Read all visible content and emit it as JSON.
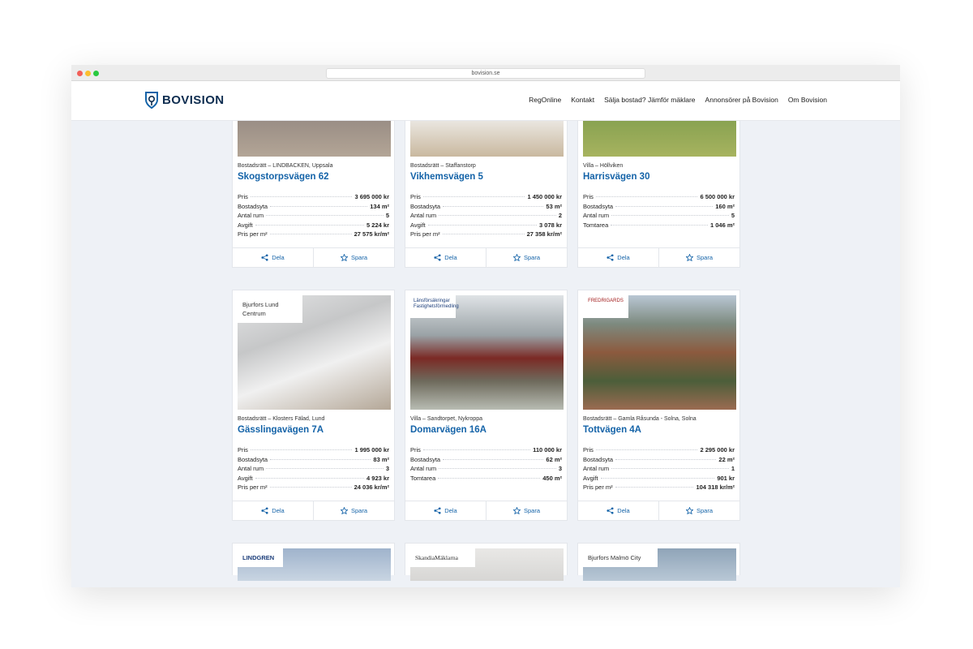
{
  "browser": {
    "url": "bovision.se"
  },
  "brand": {
    "name": "BOVISION",
    "color": "#0e2d50",
    "accent": "#1463a8"
  },
  "nav": [
    "RegOnline",
    "Kontakt",
    "Sälja bostad? Jämför mäklare",
    "Annonsörer på Bovision",
    "Om Bovision"
  ],
  "actions": {
    "share": "Dela",
    "save": "Spara"
  },
  "listings": [
    {
      "sub": "Bostadsrätt – LINDBACKEN, Uppsala",
      "title": "Skogstorpsvägen 62",
      "specs": [
        [
          "Pris",
          "3 695 000 kr"
        ],
        [
          "Bostadsyta",
          "134 m²"
        ],
        [
          "Antal rum",
          "5"
        ],
        [
          "Avgift",
          "5 224 kr"
        ],
        [
          "Pris per m²",
          "27 575 kr/m²"
        ]
      ]
    },
    {
      "sub": "Bostadsrätt – Staffanstorp",
      "title": "Vikhemsvägen 5",
      "specs": [
        [
          "Pris",
          "1 450 000 kr"
        ],
        [
          "Bostadsyta",
          "53 m²"
        ],
        [
          "Antal rum",
          "2"
        ],
        [
          "Avgift",
          "3 078 kr"
        ],
        [
          "Pris per m²",
          "27 358 kr/m²"
        ]
      ]
    },
    {
      "sub": "Villa – Höllviken",
      "title": "Harrisvägen 30",
      "specs": [
        [
          "Pris",
          "6 500 000 kr"
        ],
        [
          "Bostadsyta",
          "160 m²"
        ],
        [
          "Antal rum",
          "5"
        ],
        [
          "Tomtarea",
          "1 046 m²"
        ]
      ]
    },
    {
      "sub": "Bostadsrätt – Klosters Fälad, Lund",
      "title": "Gässlingavägen 7A",
      "img_label": "Bjurfors Lund Centrum",
      "specs": [
        [
          "Pris",
          "1 995 000 kr"
        ],
        [
          "Bostadsyta",
          "83 m²"
        ],
        [
          "Antal rum",
          "3"
        ],
        [
          "Avgift",
          "4 923 kr"
        ],
        [
          "Pris per m²",
          "24 036 kr/m²"
        ]
      ]
    },
    {
      "sub": "Villa – Sandtorpet, Nykroppa",
      "title": "Domarvägen 16A",
      "img_logo": "Länsförsäkringar Fastighetsförmedling",
      "specs": [
        [
          "Pris",
          "110 000 kr"
        ],
        [
          "Bostadsyta",
          "62 m²"
        ],
        [
          "Antal rum",
          "3"
        ],
        [
          "Tomtarea",
          "450 m²"
        ]
      ]
    },
    {
      "sub": "Bostadsrätt – Gamla Råsunda - Solna, Solna",
      "title": "Tottvägen 4A",
      "img_logo": "FREDRIGARDS",
      "specs": [
        [
          "Pris",
          "2 295 000 kr"
        ],
        [
          "Bostadsyta",
          "22 m²"
        ],
        [
          "Antal rum",
          "1"
        ],
        [
          "Avgift",
          "901 kr"
        ],
        [
          "Pris per m²",
          "104 318 kr/m²"
        ]
      ]
    }
  ],
  "partial_cards": [
    {
      "label": "LINDGREN"
    },
    {
      "label": "SkandiaMäklarna"
    },
    {
      "label": "Bjurfors Malmö City"
    }
  ]
}
